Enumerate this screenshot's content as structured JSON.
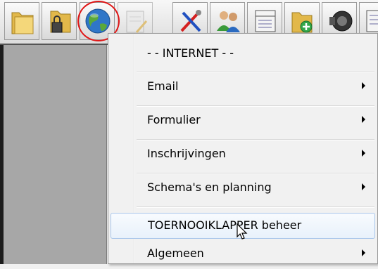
{
  "toolbar": {
    "buttons": [
      {
        "icon": "folder-icon"
      },
      {
        "icon": "locked-folder-icon"
      },
      {
        "icon": "globe-icon",
        "highlighted": true
      },
      {
        "icon": "notepad-icon"
      },
      {
        "icon": "tools-icon"
      },
      {
        "icon": "users-icon"
      },
      {
        "icon": "schedule-icon"
      },
      {
        "icon": "add-folder-icon"
      },
      {
        "icon": "speaker-icon"
      },
      {
        "icon": "document-icon"
      }
    ]
  },
  "menu": {
    "header": "- -  INTERNET  - -",
    "items": [
      {
        "label": "Email",
        "has_submenu": true
      },
      {
        "label": "Formulier",
        "has_submenu": true
      },
      {
        "label": "Inschrijvingen",
        "has_submenu": true
      },
      {
        "label": "Schema's en planning",
        "has_submenu": true
      },
      {
        "label": "TOERNOOIKLAPPER beheer",
        "has_submenu": false,
        "highlighted": true
      },
      {
        "label": "Algemeen",
        "has_submenu": true
      }
    ]
  },
  "colors": {
    "annotation_ring": "#e01818",
    "left_panel": "#a7a7a7",
    "menu_background": "#f1f1f1",
    "highlight_border": "#a9c6ea"
  }
}
